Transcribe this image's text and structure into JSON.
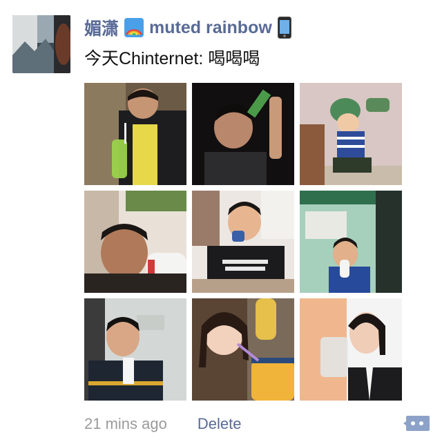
{
  "post": {
    "author": {
      "name_cn": "媚潇",
      "name_en": "muted rainbow",
      "rainbow_icon": "rainbow-icon",
      "device_icon": "phone-icon"
    },
    "text": "今天Chinternet: 喝喝喝",
    "photos": [
      {
        "icon": "photo-man-drinking-green-juice"
      },
      {
        "icon": "photo-man-drinking-bottle-dark"
      },
      {
        "icon": "photo-child-drinking"
      },
      {
        "icon": "photo-man-drinking-milk-bottle"
      },
      {
        "icon": "photo-man-journal-standard-shirt"
      },
      {
        "icon": "photo-boy-drinking-milk"
      },
      {
        "icon": "photo-boy-drinking-carton"
      },
      {
        "icon": "photo-girl-with-straw-juice"
      },
      {
        "icon": "photo-woman-drinking-water"
      }
    ],
    "timestamp": "21 mins ago",
    "delete_label": "Delete",
    "comment_icon": "comment-bubble-icon"
  },
  "colors": {
    "link": "#586a96",
    "muted": "#9a9a9a",
    "text": "#111111"
  }
}
